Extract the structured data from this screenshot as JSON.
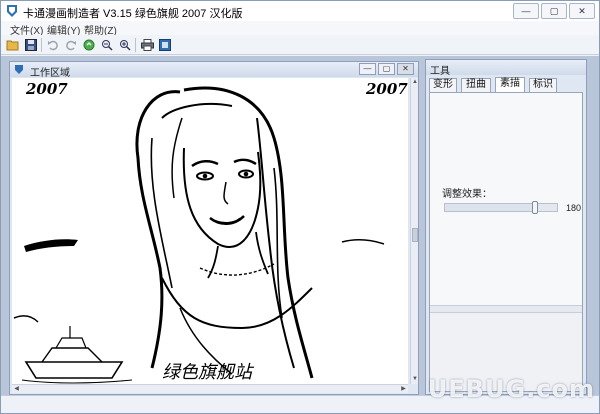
{
  "window": {
    "title": "卡通漫画制造者 V3.15 绿色旗舰 2007 汉化版",
    "min_glyph": "—",
    "max_glyph": "▢",
    "close_glyph": "✕"
  },
  "menu": [
    {
      "label": "文件(X)"
    },
    {
      "label": "编辑(Y)"
    },
    {
      "label": "帮助(Z)"
    }
  ],
  "toolbar": {
    "buttons": [
      {
        "icon": "open-folder-icon"
      },
      {
        "icon": "save-disk-icon"
      },
      {
        "icon": "undo-icon"
      },
      {
        "icon": "redo-icon"
      },
      {
        "icon": "refresh-icon"
      },
      {
        "icon": "zoom-out-icon"
      },
      {
        "icon": "zoom-in-icon"
      },
      {
        "icon": "print-icon"
      },
      {
        "icon": "export-icon"
      }
    ]
  },
  "work_area": {
    "title": "工作区域",
    "image_text": {
      "year_left": "2007",
      "year_right": "2007",
      "caption": "绿色旗舰站"
    }
  },
  "tools": {
    "title": "工具",
    "tabs": [
      {
        "label": "变形"
      },
      {
        "label": "扭曲"
      },
      {
        "label": "素描",
        "active": true
      },
      {
        "label": "标识"
      }
    ],
    "effect_label": "调整效果：",
    "effect_value": "180",
    "effect_level": 0.82
  },
  "watermark": "UEBUG.com"
}
